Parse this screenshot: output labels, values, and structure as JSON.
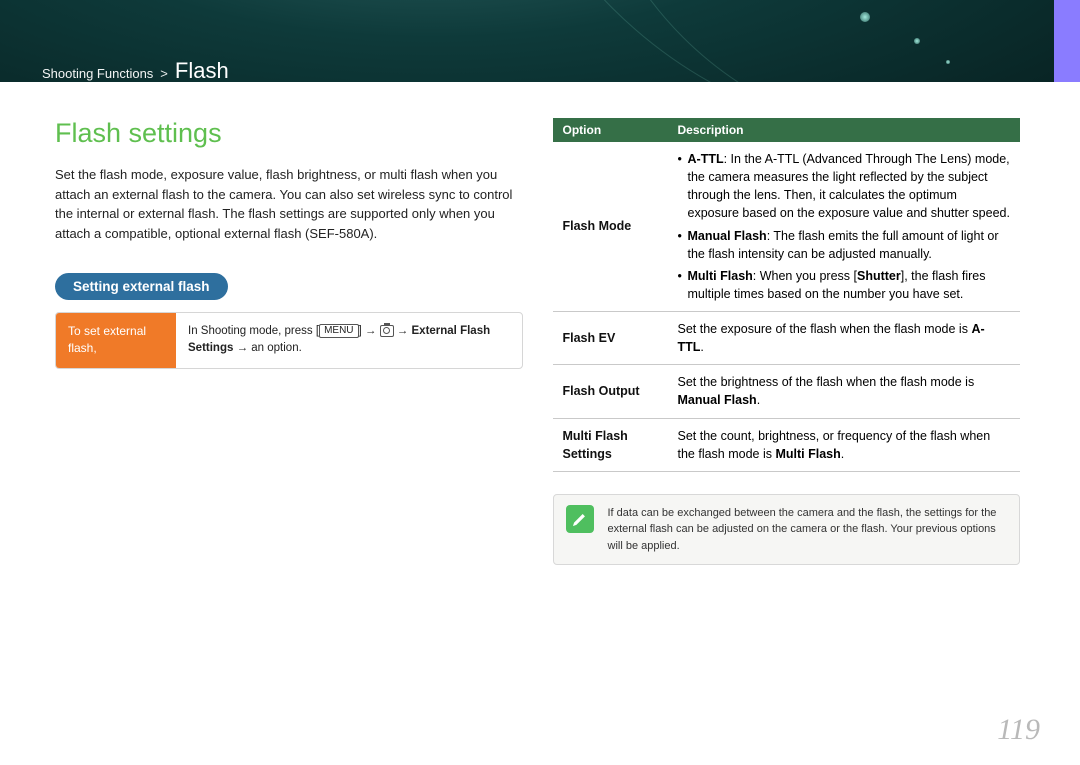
{
  "breadcrumb": {
    "chapter": "Shooting Functions",
    "section": "Flash"
  },
  "heading": "Flash settings",
  "intro": "Set the flash mode, exposure value, flash brightness, or multi flash when you attach an external flash to the camera. You can also set wireless sync to control the internal or external flash. The flash settings are supported only when you attach a compatible, optional external flash (SEF-580A).",
  "pill": "Setting external flash",
  "instr": {
    "left": "To set external flash,",
    "right_prefix": "In Shooting mode, press ",
    "menu": "MENU",
    "right_mid": " → ",
    "right_bold1": "External Flash Settings",
    "right_suffix": " → an option."
  },
  "table": {
    "head_option": "Option",
    "head_desc": "Description",
    "rows": [
      {
        "option": "Flash Mode",
        "bullets": [
          {
            "bold": "A-TTL",
            "text": ": In the A-TTL (Advanced Through The Lens) mode, the camera measures the light reflected by the subject through the lens. Then, it calculates the optimum exposure based on the exposure value and shutter speed."
          },
          {
            "bold": "Manual Flash",
            "text": ": The flash emits the full amount of light or the flash intensity can be adjusted manually."
          },
          {
            "bold": "Multi Flash",
            "text_pre": ": When you press [",
            "bold2": "Shutter",
            "text_post": "], the flash fires multiple times based on the number you have set."
          }
        ]
      },
      {
        "option": "Flash EV",
        "desc_pre": "Set the exposure of the flash when the flash mode is ",
        "desc_bold": "A-TTL",
        "desc_post": "."
      },
      {
        "option": "Flash Output",
        "desc_pre": "Set the brightness of the flash when the flash mode is ",
        "desc_bold": "Manual Flash",
        "desc_post": "."
      },
      {
        "option": "Multi Flash Settings",
        "desc_pre": "Set the count, brightness, or frequency of the flash when the flash mode is ",
        "desc_bold": "Multi Flash",
        "desc_post": "."
      }
    ]
  },
  "note": "If data can be exchanged between the camera and the flash, the settings for the external flash can be adjusted on the camera or the flash. Your previous options will be applied.",
  "page_number": "119"
}
